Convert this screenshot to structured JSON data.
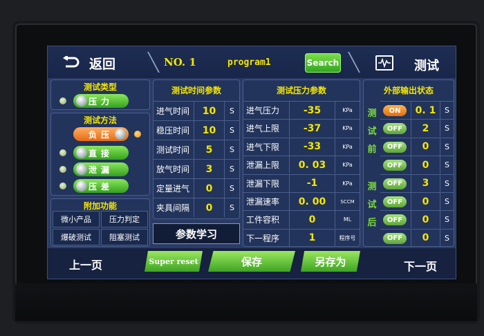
{
  "topbar": {
    "back_label": "返回",
    "no_label": "NO. 1",
    "program_name": "program1",
    "search_label": "Search",
    "title": "测试"
  },
  "test_type": {
    "title": "测试类型",
    "options": [
      {
        "label": "压力"
      }
    ]
  },
  "test_method": {
    "title": "测试方法",
    "options": [
      {
        "label": "负压",
        "active": true
      },
      {
        "label": "直接"
      },
      {
        "label": "泄漏"
      },
      {
        "label": "压差"
      }
    ]
  },
  "extra": {
    "title": "附加功能",
    "buttons": [
      "微小产品",
      "压力判定",
      "爆破测试",
      "阻塞测试"
    ]
  },
  "time_params": {
    "title": "测试时间参数",
    "rows": [
      {
        "label": "进气时间",
        "value": "10",
        "unit": "S"
      },
      {
        "label": "稳压时间",
        "value": "10",
        "unit": "S"
      },
      {
        "label": "测试时间",
        "value": "5",
        "unit": "S"
      },
      {
        "label": "放气时间",
        "value": "3",
        "unit": "S"
      },
      {
        "label": "定量进气",
        "value": "0",
        "unit": "S"
      },
      {
        "label": "夹具间隔",
        "value": "0",
        "unit": "S"
      }
    ],
    "learn_label": "参数学习"
  },
  "pressure_params": {
    "title": "测试压力参数",
    "rows": [
      {
        "label": "进气压力",
        "value": "-35",
        "unit": "KPa"
      },
      {
        "label": "进气上限",
        "value": "-37",
        "unit": "KPa"
      },
      {
        "label": "进气下限",
        "value": "-33",
        "unit": "KPa"
      },
      {
        "label": "泄漏上限",
        "value": "0. 03",
        "unit": "KPa"
      },
      {
        "label": "泄漏下限",
        "value": "-1",
        "unit": "KPa"
      },
      {
        "label": "泄漏速率",
        "value": "0. 00",
        "unit": "SCCM"
      },
      {
        "label": "工件容积",
        "value": "0",
        "unit": "ML"
      },
      {
        "label": "下一程序",
        "value": "1",
        "unit": "程序号"
      }
    ]
  },
  "external": {
    "title": "外部输出状态",
    "before_label": [
      "测",
      "试",
      "前"
    ],
    "after_label": [
      "测",
      "试",
      "后"
    ],
    "rows": [
      {
        "state": "ON",
        "value": "0. 1",
        "unit": "S"
      },
      {
        "state": "OFF",
        "value": "2",
        "unit": "S"
      },
      {
        "state": "OFF",
        "value": "0",
        "unit": "S"
      },
      {
        "state": "OFF",
        "value": "0",
        "unit": "S"
      },
      {
        "state": "OFF",
        "value": "3",
        "unit": "S"
      },
      {
        "state": "OFF",
        "value": "0",
        "unit": "S"
      },
      {
        "state": "OFF",
        "value": "0",
        "unit": "S"
      },
      {
        "state": "OFF",
        "value": "0",
        "unit": "S"
      }
    ]
  },
  "bottom": {
    "prev_label": "上一页",
    "super_reset_label": "Super reset",
    "save_label": "保存",
    "save_as_label": "另存为",
    "next_label": "下一页"
  },
  "colors": {
    "accent_yellow": "#f5e600",
    "green": "#4cb82c",
    "orange": "#e87a1e"
  }
}
